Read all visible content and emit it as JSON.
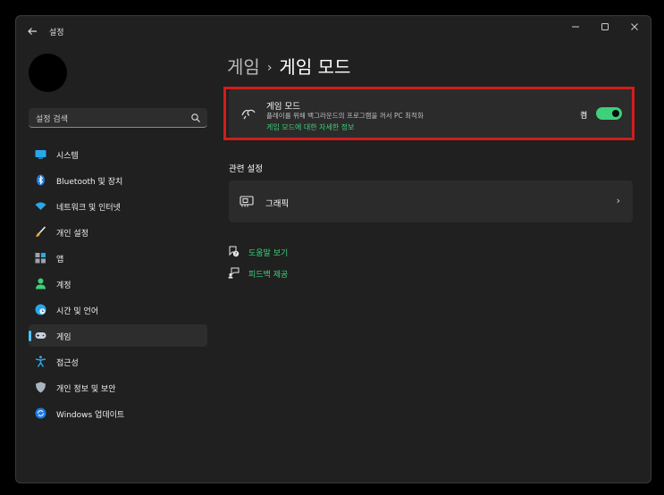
{
  "window": {
    "title": "설정"
  },
  "search": {
    "placeholder": "설정 검색"
  },
  "sidebar": {
    "items": [
      {
        "label": "시스템"
      },
      {
        "label": "Bluetooth 및 장치"
      },
      {
        "label": "네트워크 및 인터넷"
      },
      {
        "label": "개인 설정"
      },
      {
        "label": "앱"
      },
      {
        "label": "계정"
      },
      {
        "label": "시간 및 언어"
      },
      {
        "label": "게임",
        "selected": true
      },
      {
        "label": "접근성"
      },
      {
        "label": "개인 정보 및 보안"
      },
      {
        "label": "Windows 업데이트"
      }
    ]
  },
  "breadcrumb": {
    "parent": "게임",
    "separator": "›",
    "current": "게임 모드"
  },
  "game_mode": {
    "title": "게임 모드",
    "description": "플레이를 위해 백그라운드의 프로그램을 꺼서 PC 최적화",
    "link": "게임 모드에 대한 자세한 정보",
    "state_label": "켬",
    "enabled": true
  },
  "related": {
    "title": "관련 설정",
    "items": [
      {
        "label": "그래픽"
      }
    ]
  },
  "help": {
    "get_help": "도움말 보기",
    "feedback": "피드백 제공"
  },
  "colors": {
    "accent_green": "#3ed07a",
    "highlight_red": "#d11c1c",
    "nav_indicator": "#4cc2ff"
  }
}
